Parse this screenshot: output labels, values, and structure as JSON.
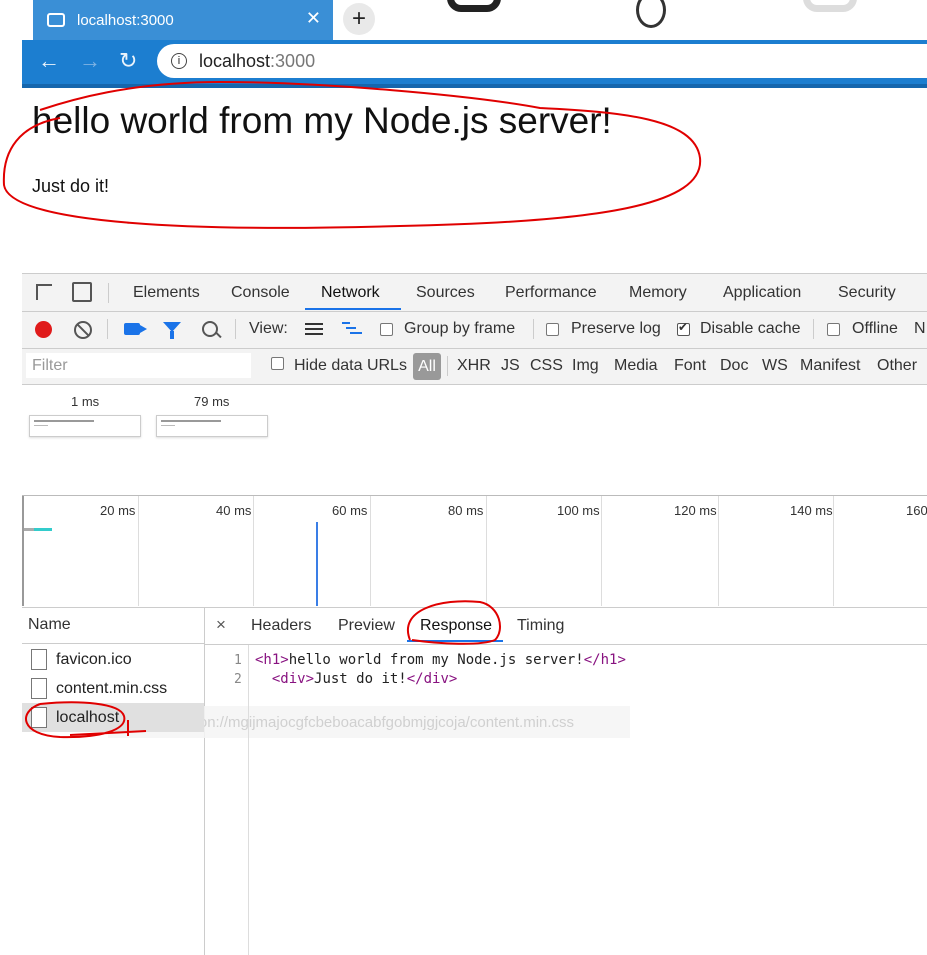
{
  "browser": {
    "tab_title": "localhost:3000",
    "tab_close": "✕",
    "new_tab": "+",
    "url_host": "localhost",
    "url_port": ":3000"
  },
  "page": {
    "heading": "hello world from my Node.js server!",
    "paragraph": "Just do it!"
  },
  "devtools": {
    "tabs": [
      "Elements",
      "Console",
      "Network",
      "Sources",
      "Performance",
      "Memory",
      "Application",
      "Security"
    ],
    "active_tab": "Network",
    "toolbar": {
      "view_label": "View:",
      "group_by_frame": "Group by frame",
      "preserve_log": "Preserve log",
      "disable_cache": "Disable cache",
      "offline": "Offline",
      "overflow": "N"
    },
    "filter": {
      "placeholder": "Filter",
      "hide_data_urls": "Hide data URLs",
      "types": [
        "All",
        "XHR",
        "JS",
        "CSS",
        "Img",
        "Media",
        "Font",
        "Doc",
        "WS",
        "Manifest",
        "Other"
      ]
    },
    "screenshots": [
      {
        "time": "1 ms"
      },
      {
        "time": "79 ms"
      }
    ],
    "timeline_labels": [
      "20 ms",
      "40 ms",
      "60 ms",
      "80 ms",
      "100 ms",
      "120 ms",
      "140 ms",
      "160"
    ],
    "name_header": "Name",
    "files": [
      "favicon.ico",
      "content.min.css",
      "localhost"
    ],
    "detail": {
      "close": "×",
      "tabs": [
        "Headers",
        "Preview",
        "Response",
        "Timing"
      ],
      "active_tab": "Response",
      "line_numbers": [
        "1",
        "2"
      ]
    },
    "tooltip": "e-extension://mgijmajocgfcbeboacabfgobmjgjcoja/content.min.css"
  },
  "colors": {
    "tab_blue": "#3a8fd6",
    "toolbar_blue": "#1c7ed0",
    "annotation_red": "#e00000",
    "accent": "#1a73e8"
  }
}
